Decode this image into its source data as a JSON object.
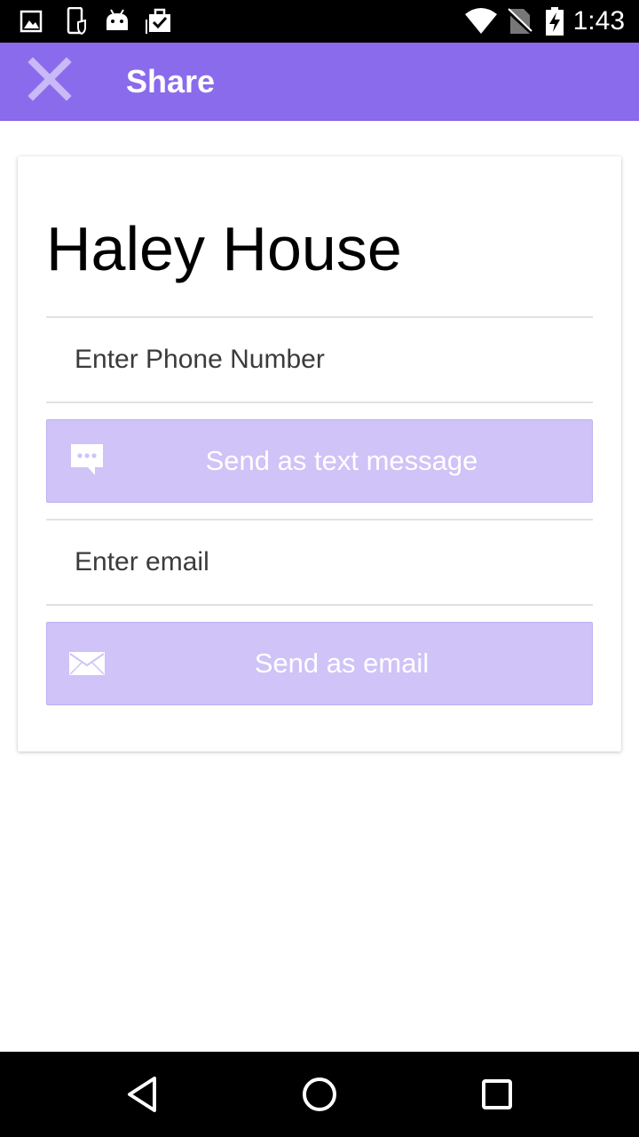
{
  "status_bar": {
    "time": "1:43",
    "left_icons": [
      "image-icon",
      "phone-shield-icon",
      "android-icon",
      "clipboard-check-icon"
    ],
    "right_icons": [
      "wifi-icon",
      "no-sim-icon",
      "battery-charging-icon"
    ]
  },
  "app_bar": {
    "title": "Share",
    "close_icon": "close-icon",
    "background": "#8a6bec"
  },
  "card": {
    "contact_name": "Haley House",
    "phone": {
      "placeholder": "Enter Phone Number",
      "value": ""
    },
    "sms_button": {
      "label": "Send as text message",
      "icon": "chat-bubble-icon"
    },
    "email": {
      "placeholder": "Enter email",
      "value": ""
    },
    "email_button": {
      "label": "Send as email",
      "icon": "envelope-icon"
    },
    "button_color": "#cfc3f7"
  },
  "nav_bar": {
    "items": [
      "back-icon",
      "home-icon",
      "recents-icon"
    ]
  }
}
